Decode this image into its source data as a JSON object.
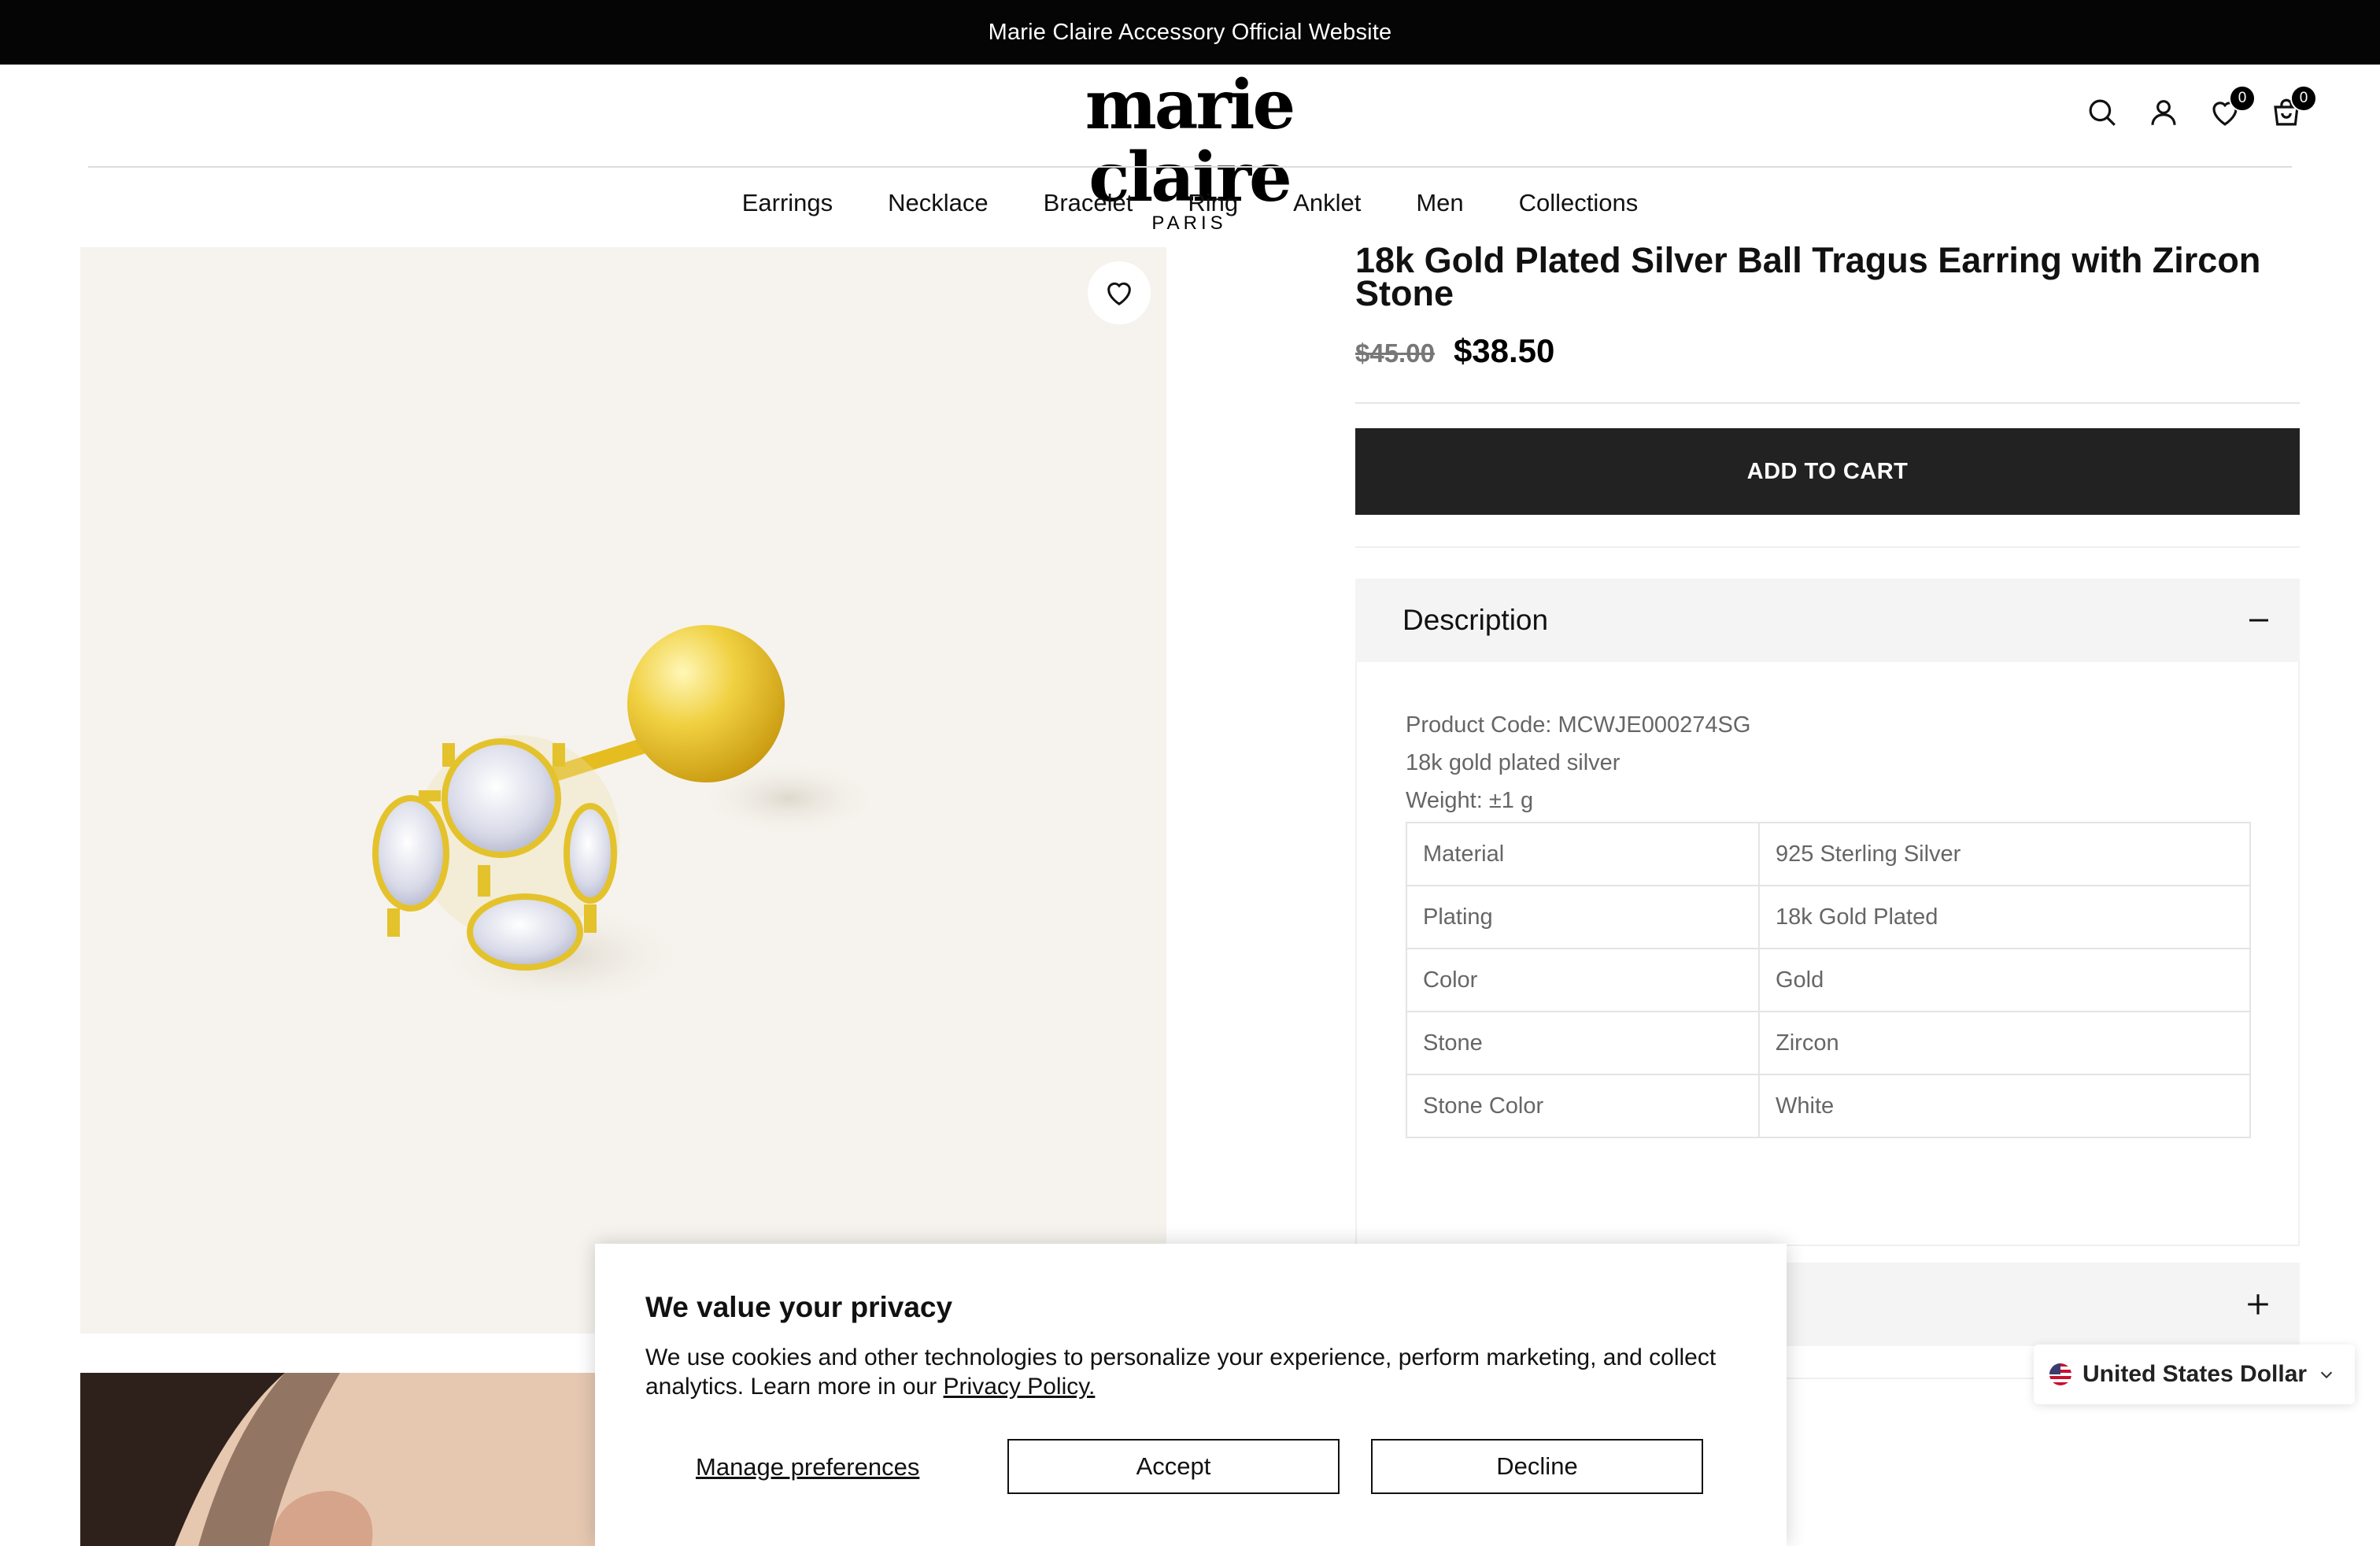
{
  "announcement": "Marie Claire Accessory Official Website",
  "logo": {
    "name": "marie claire",
    "sub": "PARIS"
  },
  "header_icons": [
    {
      "name": "search-icon"
    },
    {
      "name": "account-icon"
    },
    {
      "name": "wishlist-icon",
      "count": "0"
    },
    {
      "name": "cart-icon",
      "count": "0"
    }
  ],
  "nav": [
    "Earrings",
    "Necklace",
    "Bracelet",
    "Ring",
    "Anklet",
    "Men",
    "Collections"
  ],
  "product": {
    "title": "18k Gold Plated Silver Ball Tragus Earring with Zircon Stone",
    "old_price": "$45.00",
    "price": "$38.50",
    "add_to_cart": "ADD TO CART"
  },
  "description": {
    "heading": "Description",
    "lines": [
      "Product Code: MCWJE000274SG",
      "18k gold plated silver",
      "Weight: ±1 g"
    ],
    "specs": [
      [
        "Material",
        "925 Sterling Silver"
      ],
      [
        "Plating",
        "18k Gold Plated"
      ],
      [
        "Color",
        "Gold"
      ],
      [
        "Stone",
        "Zircon"
      ],
      [
        "Stone Color",
        "White"
      ]
    ]
  },
  "currency": "United States Dollar",
  "cookie": {
    "title": "We value your privacy",
    "text": "We use cookies and other technologies to personalize your experience, perform marketing, and collect analytics. Learn more in our",
    "link": "Privacy Policy.",
    "manage": "Manage preferences",
    "accept": "Accept",
    "decline": "Decline"
  },
  "colors": {
    "topbar": "#050505",
    "button": "#222222",
    "accordion": "#f4f4f4",
    "gold": "#e8c53a"
  }
}
